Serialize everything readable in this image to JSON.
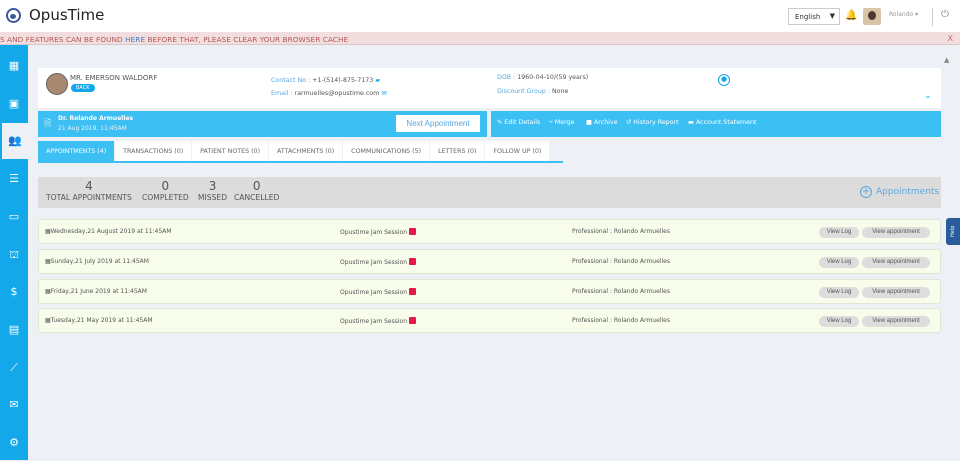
{
  "header": {
    "brand": "OpusTime",
    "language": "English",
    "user": "Rolando"
  },
  "banner": {
    "text_before": "S AND FEATURES CAN BE FOUND ",
    "link": "HERE",
    "text_after": " BEFORE THAT, PLEASE CLEAR YOUR BROWSER CACHE",
    "close": "X"
  },
  "sidebar": {
    "items": [
      {
        "icon": "dashboard-icon",
        "glyph": "▦"
      },
      {
        "icon": "calendar-icon",
        "glyph": "▣"
      },
      {
        "icon": "patients-icon",
        "glyph": "👥"
      },
      {
        "icon": "list-icon",
        "glyph": "☰"
      },
      {
        "icon": "card-icon",
        "glyph": "▭"
      },
      {
        "icon": "basket-icon",
        "glyph": "⛫"
      },
      {
        "icon": "dollar-icon",
        "glyph": "$"
      },
      {
        "icon": "contact-icon",
        "glyph": "▤"
      },
      {
        "icon": "chart-icon",
        "glyph": "⟋"
      },
      {
        "icon": "mail-icon",
        "glyph": "✉"
      },
      {
        "icon": "settings-icon",
        "glyph": "⚙"
      }
    ]
  },
  "patient": {
    "name": "MR. EMERSON WALDORF",
    "back": "BACK",
    "contact_label": "Contact No :",
    "contact": "+1-(514)-875-7173",
    "email_label": "Email :",
    "email": "rarmuelles@opustime.com",
    "dob_label": "DOB :",
    "dob": "1960-04-10/(59 years)",
    "discount_label": "Discount Group :",
    "discount": "None"
  },
  "doctor": {
    "name": "Dr. Rolando Armuelles",
    "time": "21 Aug 2019, 11:45AM",
    "next": "Next Appointment"
  },
  "actions": [
    "Edit Details",
    "Merge",
    "Archive",
    "History Report",
    "Account Statement"
  ],
  "tabs": [
    "APPOINTMENTS (4)",
    "TRANSACTIONS (0)",
    "PATIENT NOTES (0)",
    "ATTACHMENTS (0)",
    "COMMUNICATIONS (5)",
    "LETTERS (0)",
    "FOLLOW UP (0)"
  ],
  "stats": [
    {
      "n": "4",
      "l": "TOTAL APPOINTMENTS"
    },
    {
      "n": "0",
      "l": "COMPLETED"
    },
    {
      "n": "3",
      "l": "MISSED"
    },
    {
      "n": "0",
      "l": "CANCELLED"
    }
  ],
  "add_appointments": "Appointments",
  "appointments": [
    {
      "date": "Wednesday,21 August 2019 at 11:45AM",
      "session": "Opustime Jam Session",
      "professional": "Professional : Rolando Armuelles"
    },
    {
      "date": "Sunday,21 July 2019 at 11:45AM",
      "session": "Opustime Jam Session",
      "professional": "Professional : Rolando Armuelles"
    },
    {
      "date": "Friday,21 June 2019 at 11:45AM",
      "session": "Opustime Jam Session",
      "professional": "Professional : Rolando Armuelles"
    },
    {
      "date": "Tuesday,21 May 2019 at 11:45AM",
      "session": "Opustime Jam Session",
      "professional": "Professional : Rolando Armuelles"
    }
  ],
  "row_buttons": {
    "log": "View Log",
    "view": "View appointment"
  },
  "help": "Help"
}
